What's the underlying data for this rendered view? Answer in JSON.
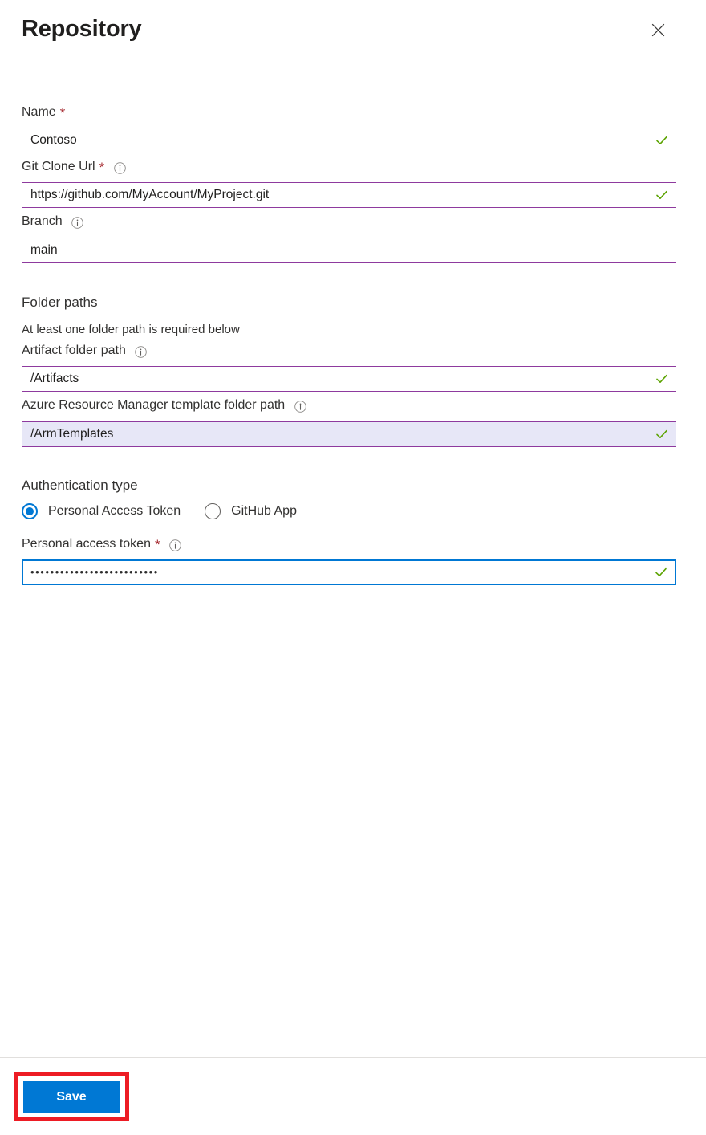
{
  "header": {
    "title": "Repository",
    "close_icon": "close-icon"
  },
  "form": {
    "fields": [
      {
        "label": "Name",
        "required": true,
        "has_info": false,
        "value": "Contoso",
        "valid": true,
        "state": "normal"
      },
      {
        "label": "Git Clone Url",
        "required": true,
        "has_info": true,
        "value": "https://github.com/MyAccount/MyProject.git",
        "valid": true,
        "state": "normal"
      },
      {
        "label": "Branch",
        "required": false,
        "has_info": true,
        "value": "main",
        "valid": false,
        "state": "normal"
      }
    ]
  },
  "folder_paths": {
    "heading": "Folder paths",
    "note": "At least one folder path is required below",
    "fields": [
      {
        "label": "Artifact folder path",
        "required": false,
        "has_info": true,
        "value": "/Artifacts",
        "valid": true,
        "state": "normal"
      },
      {
        "label": "Azure Resource Manager template folder path",
        "required": false,
        "has_info": true,
        "value": "/ArmTemplates",
        "valid": true,
        "state": "highlighted"
      }
    ]
  },
  "authentication": {
    "heading": "Authentication type",
    "options": [
      {
        "label": "Personal Access Token",
        "selected": true
      },
      {
        "label": "GitHub App",
        "selected": false
      }
    ],
    "token_field": {
      "label": "Personal access token",
      "required": true,
      "has_info": true,
      "masked_value": "••••••••••••••••••••••••••",
      "valid": true,
      "state": "focused"
    }
  },
  "footer": {
    "save_label": "Save"
  },
  "colors": {
    "accent_blue": "#0078d4",
    "field_border_purple": "#8e3a9e",
    "valid_green": "#5ba300",
    "required_red": "#a4262c",
    "highlight_red": "#ed1c24",
    "field_highlight_bg": "#e7e7f7"
  }
}
